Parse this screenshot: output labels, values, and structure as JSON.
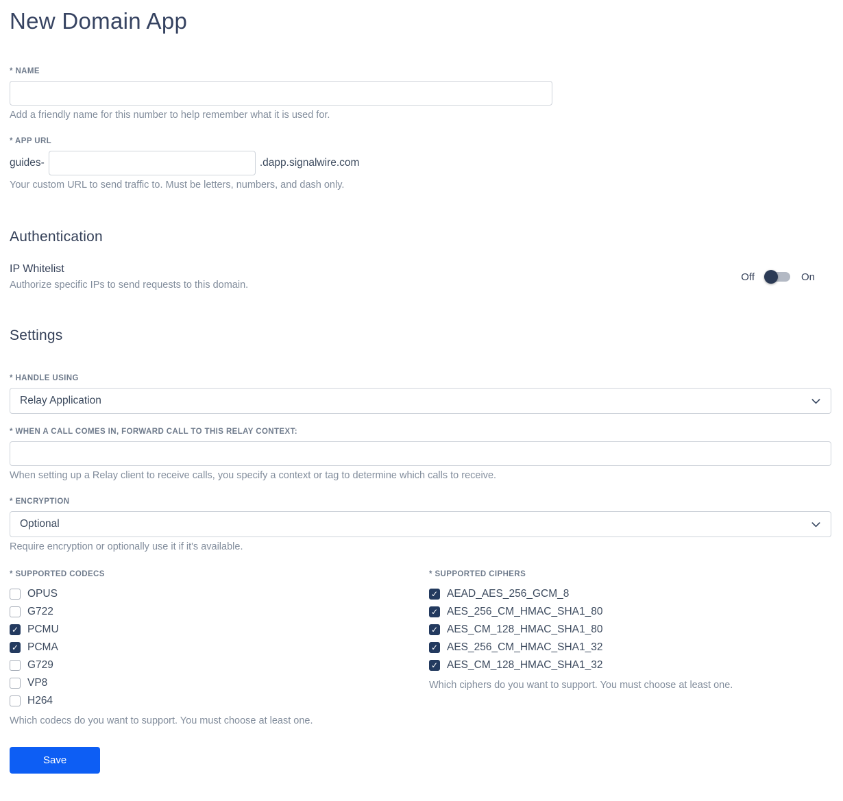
{
  "page": {
    "title": "New Domain App"
  },
  "colors": {
    "accent_blue": "#0d5ef4",
    "checkbox_checked": "#233a5f",
    "toggle_knob": "#2b3a55",
    "heading_text": "#333f57",
    "label_text": "#6e7a8b",
    "helper_text": "#828d9c"
  },
  "name_field": {
    "label": "* NAME",
    "value": "",
    "helper": "Add a friendly name for this number to help remember what it is used for."
  },
  "app_url_field": {
    "label": "* APP URL",
    "prefix": "guides-",
    "value": "",
    "suffix": ".dapp.signalwire.com",
    "helper": "Your custom URL to send traffic to. Must be letters, numbers, and dash only."
  },
  "authentication": {
    "heading": "Authentication",
    "ip_whitelist": {
      "label": "IP Whitelist",
      "helper": "Authorize specific IPs to send requests to this domain.",
      "off_label": "Off",
      "on_label": "On",
      "state": "off"
    }
  },
  "settings": {
    "heading": "Settings",
    "handle_using": {
      "label": "* HANDLE USING",
      "selected": "Relay Application"
    },
    "relay_context": {
      "label": "* WHEN A CALL COMES IN, FORWARD CALL TO THIS RELAY CONTEXT:",
      "value": "",
      "helper": "When setting up a Relay client to receive calls, you specify a context or tag to determine which calls to receive."
    },
    "encryption": {
      "label": "* ENCRYPTION",
      "selected": "Optional",
      "helper": "Require encryption or optionally use it if it's available."
    },
    "codecs": {
      "label": "* SUPPORTED CODECS",
      "options": [
        {
          "label": "OPUS",
          "checked": false
        },
        {
          "label": "G722",
          "checked": false
        },
        {
          "label": "PCMU",
          "checked": true
        },
        {
          "label": "PCMA",
          "checked": true
        },
        {
          "label": "G729",
          "checked": false
        },
        {
          "label": "VP8",
          "checked": false
        },
        {
          "label": "H264",
          "checked": false
        }
      ],
      "helper": "Which codecs do you want to support. You must choose at least one."
    },
    "ciphers": {
      "label": "* SUPPORTED CIPHERS",
      "options": [
        {
          "label": "AEAD_AES_256_GCM_8",
          "checked": true
        },
        {
          "label": "AES_256_CM_HMAC_SHA1_80",
          "checked": true
        },
        {
          "label": "AES_CM_128_HMAC_SHA1_80",
          "checked": true
        },
        {
          "label": "AES_256_CM_HMAC_SHA1_32",
          "checked": true
        },
        {
          "label": "AES_CM_128_HMAC_SHA1_32",
          "checked": true
        }
      ],
      "helper": "Which ciphers do you want to support. You must choose at least one."
    }
  },
  "actions": {
    "save_label": "Save"
  }
}
